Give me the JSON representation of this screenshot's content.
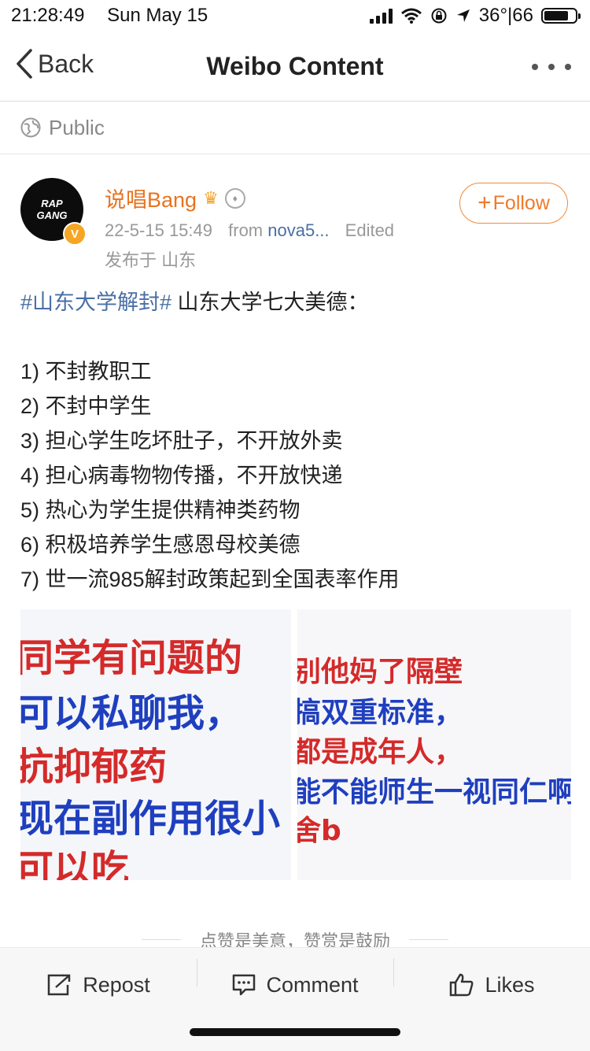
{
  "status_bar": {
    "time": "21:28:49",
    "date": "Sun May 15",
    "temperature": "36°|66",
    "battery_level": 0.8
  },
  "nav": {
    "back_label": "Back",
    "title": "Weibo Content"
  },
  "visibility": {
    "label": "Public"
  },
  "post": {
    "avatar_text": [
      "RAP",
      "GANG"
    ],
    "avatar_badge": "V",
    "user_name": "说唱Bang",
    "timestamp": "22-5-15 15:49",
    "source_prefix": "from",
    "source": "nova5...",
    "edited": "Edited",
    "location": "发布于 山东",
    "follow_label": "Follow",
    "hashtag": "#山东大学解封#",
    "intro": " 山东大学七大美德：",
    "points": [
      "1) 不封教职工",
      "2) 不封中学生",
      "3) 担心学生吃坏肚子，不开放外卖",
      "4) 担心病毒物物传播，不开放快递",
      "5) 热心为学生提供精神类药物",
      "6) 积极培养学生感恩母校美德",
      "7) 世一流985解封政策起到全国表率作用"
    ],
    "images": [
      {
        "lines": [
          "同学有问题的",
          "可以私聊我，",
          "抗抑郁药",
          "现在副作用很小",
          "可以吃"
        ],
        "colors": [
          "#d42a2a",
          "#1f3fbf",
          "#d42a2a",
          "#1f3fbf",
          "#d42a2a"
        ]
      },
      {
        "lines": [
          "别他妈了隔壁",
          "搞双重标准，",
          "都是成年人，",
          "能不能师生一视同仁啊",
          "舍b"
        ],
        "colors": [
          "#d42a2a",
          "#1f3fbf",
          "#d42a2a",
          "#1f3fbf",
          "#d42a2a"
        ]
      }
    ],
    "reward_hint": "点赞是美意，赞赏是鼓励"
  },
  "actions": {
    "repost": "Repost",
    "comment": "Comment",
    "likes": "Likes"
  }
}
